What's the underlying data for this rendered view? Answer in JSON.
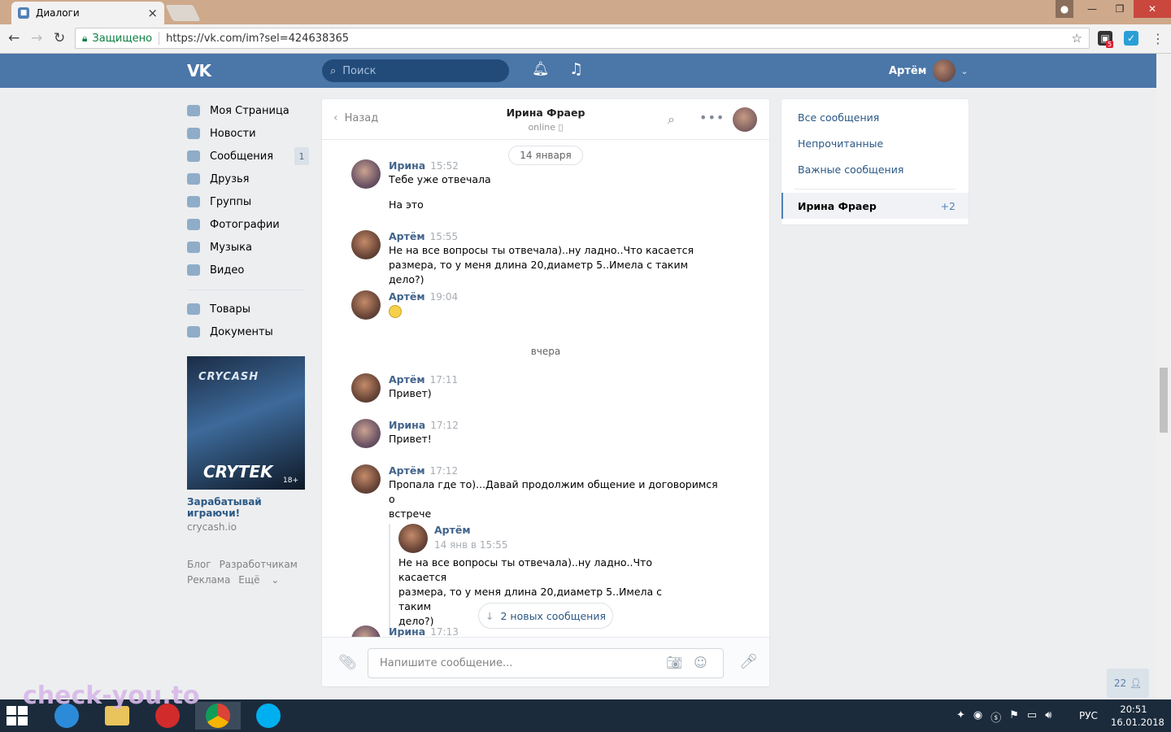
{
  "browser": {
    "tab_title": "Диалоги",
    "secure_label": "Защищено",
    "url": "https://vk.com/im?sel=424638365",
    "ext_badge": "5"
  },
  "vk_header": {
    "logo": "VK",
    "search_placeholder": "Поиск",
    "user_name": "Артём"
  },
  "sidebar": {
    "items": [
      {
        "label": "Моя Страница",
        "icon": "home-icon"
      },
      {
        "label": "Новости",
        "icon": "news-icon"
      },
      {
        "label": "Сообщения",
        "icon": "messages-icon",
        "badge": "1"
      },
      {
        "label": "Друзья",
        "icon": "friends-icon"
      },
      {
        "label": "Группы",
        "icon": "groups-icon"
      },
      {
        "label": "Фотографии",
        "icon": "photos-icon"
      },
      {
        "label": "Музыка",
        "icon": "music-icon"
      },
      {
        "label": "Видео",
        "icon": "video-icon"
      }
    ],
    "items2": [
      {
        "label": "Товары",
        "icon": "goods-icon"
      },
      {
        "label": "Документы",
        "icon": "documents-icon"
      }
    ],
    "ad": {
      "top_text": "CRYCASH",
      "bottom_text": "CRYTEK",
      "age": "18+",
      "title": "Зарабатывай играючи!",
      "domain": "crycash.io"
    },
    "footer": [
      "Блог",
      "Разработчикам",
      "Реклама",
      "Ещё"
    ]
  },
  "chat": {
    "back_label": "Назад",
    "peer_name": "Ирина Фраер",
    "peer_status": "online",
    "date_pill": "14 января",
    "day_label": "вчера",
    "messages": [
      {
        "author": "Ирина",
        "time": "15:52",
        "lines": [
          "Тебе уже отвечала"
        ],
        "extra": "На это"
      },
      {
        "author": "Артём",
        "time": "15:55",
        "lines": [
          "Не на все вопросы ты отвечала)..ну ладно..Что касается",
          "размера, то у меня длина 20,диаметр 5..Имела с таким дело?)"
        ]
      },
      {
        "author": "Артём",
        "time": "19:04",
        "emoji": "smiley"
      },
      {
        "author": "Артём",
        "time": "17:11",
        "lines": [
          "Привет)"
        ]
      },
      {
        "author": "Ирина",
        "time": "17:12",
        "lines": [
          "Привет!"
        ]
      },
      {
        "author": "Артём",
        "time": "17:12",
        "lines": [
          "Пропала где то)...Давай продолжим общение и договоримся о",
          "встрече"
        ]
      },
      {
        "author": "Ирина",
        "time": "17:13"
      }
    ],
    "forwarded": {
      "author": "Артём",
      "date": "14 янв в 15:55",
      "lines": [
        "Не на все вопросы ты отвечала)..ну ладно..Что касается",
        "размера, то у меня длина 20,диаметр 5..Имела с таким",
        "дело?)"
      ]
    },
    "new_messages_label": "2 новых сообщения",
    "composer_placeholder": "Напишите сообщение..."
  },
  "right_panel": {
    "items": [
      "Все сообщения",
      "Непрочитанные",
      "Важные сообщения"
    ],
    "active": {
      "name": "Ирина Фраер",
      "count": "+2"
    }
  },
  "online_counter": "22",
  "taskbar": {
    "lang": "РУС",
    "time": "20:51",
    "date": "16.01.2018"
  },
  "watermark": "check-you.to"
}
